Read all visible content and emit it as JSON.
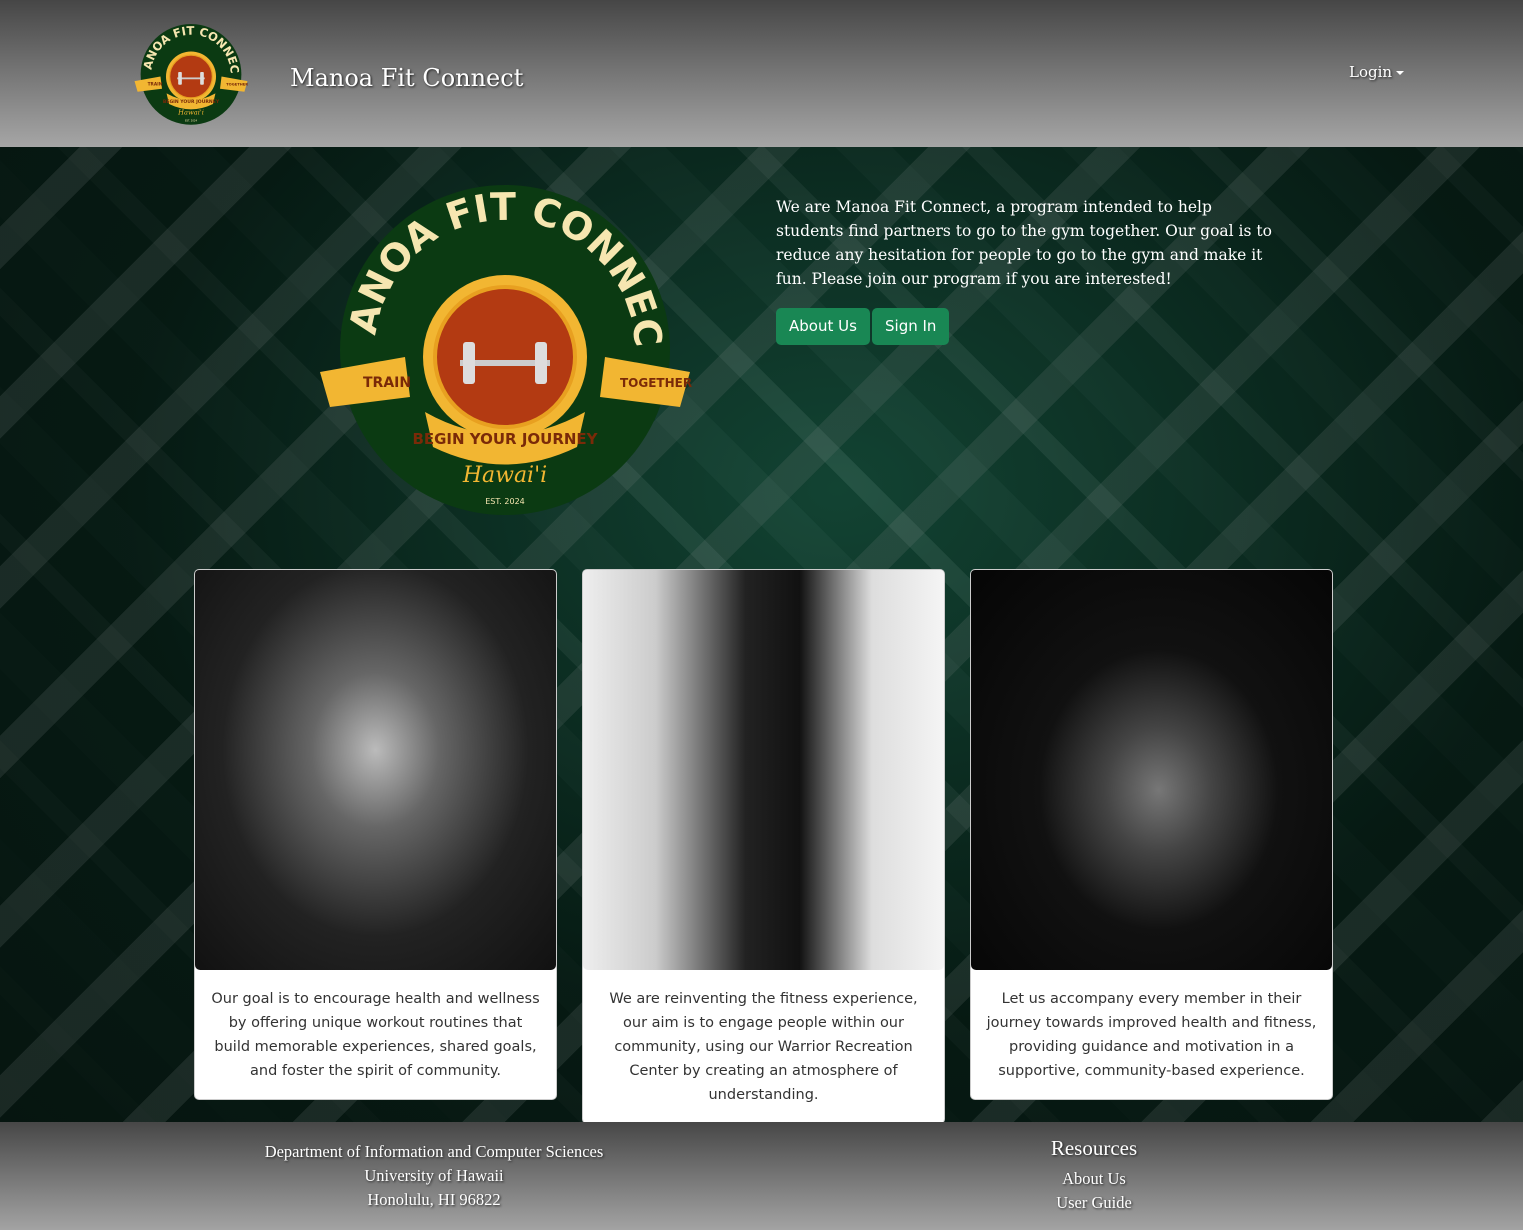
{
  "header": {
    "brand": "Manoa Fit Connect",
    "login": "Login",
    "logo_text": "MANOA FIT CONNECT"
  },
  "hero": {
    "logo": {
      "title": "MANOA FIT CONNECT",
      "left_ribbon": "TRAIN",
      "right_ribbon": "TOGETHER",
      "banner": "BEGIN YOUR JOURNEY",
      "script": "Hawai'i",
      "est": "EST. 2024"
    },
    "intro": "We are Manoa Fit Connect, a program intended to help students find partners to go to the gym together. Our goal is to reduce any hesitation for people to go to the gym and make it fun. Please join our program if you are interested!",
    "about_button": "About Us",
    "signin_button": "Sign In"
  },
  "cards": [
    {
      "text": "Our goal is to encourage health and wellness by offering unique workout routines that build memorable experiences, shared goals, and foster the spirit of community."
    },
    {
      "text": "We are reinventing the fitness experience, our aim is to engage people within our community, using our Warrior Recreation Center by creating an atmosphere of understanding."
    },
    {
      "text": "Let us accompany every member in their journey towards improved health and fitness, providing guidance and motivation in a supportive, community-based experience."
    }
  ],
  "footer": {
    "address": [
      "Department of Information and Computer Sciences",
      "University of Hawaii",
      "Honolulu, HI 96822"
    ],
    "resources_title": "Resources",
    "links": [
      "About Us",
      "User Guide"
    ]
  },
  "colors": {
    "accent": "#198754",
    "logo_green": "#0b3a12",
    "logo_gold": "#f2b632",
    "logo_red": "#b33a12"
  }
}
